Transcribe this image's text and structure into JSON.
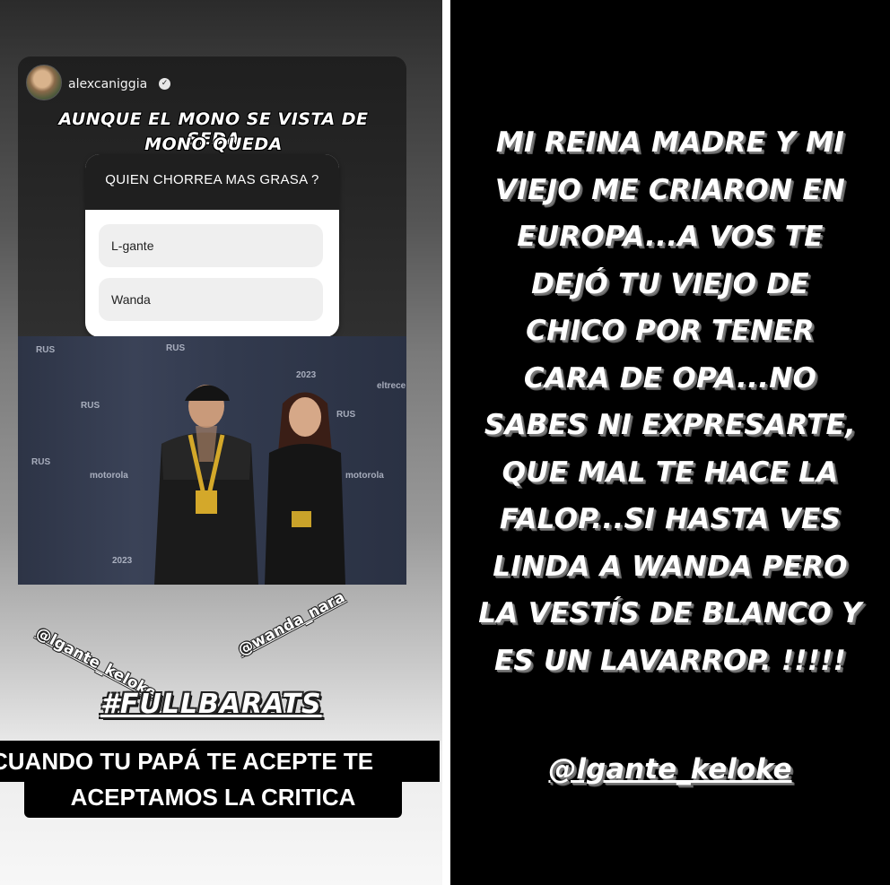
{
  "left_story": {
    "username": "alexcaniggia",
    "quote_line1": "AUNQUE EL MONO SE VISTA DE SEDA",
    "quote_line2": "MONO QUEDA",
    "poll": {
      "question": "QUIEN CHORREA MAS GRASA ?",
      "options": [
        "L-gante",
        "Wanda"
      ]
    },
    "photo_logos": [
      "RUS",
      "RUS",
      "RUS",
      "RUS",
      "RUS",
      "motorola",
      "motorola",
      "eltrece",
      "2023",
      "2023"
    ],
    "tags": [
      "@lgante_keloke",
      "@wanda_nara"
    ],
    "hashtag": "#FULLBARATS",
    "caption_line1": "CUANDO TU PAPÁ TE ACEPTE TE",
    "caption_line2": "ACEPTAMOS  LA CRITICA"
  },
  "right_story": {
    "lines": [
      "MI REINA MADRE Y MI",
      "VIEJO ME CRIARON EN",
      "EUROPA...A VOS TE",
      "DEJÓ TU VIEJO DE",
      "CHICO POR TENER",
      "CARA DE OPA...NO",
      "SABES NI EXPRESARTE,",
      "QUE MAL TE HACE LA",
      "FALOP...SI HASTA VES",
      "LINDA A WANDA PERO",
      "LA VESTÍS DE BLANCO Y",
      "ES UN LAVARROP. !!!!!"
    ],
    "mention": "@lgante_keloke"
  },
  "icons": {
    "verified": "verified-badge-icon"
  }
}
